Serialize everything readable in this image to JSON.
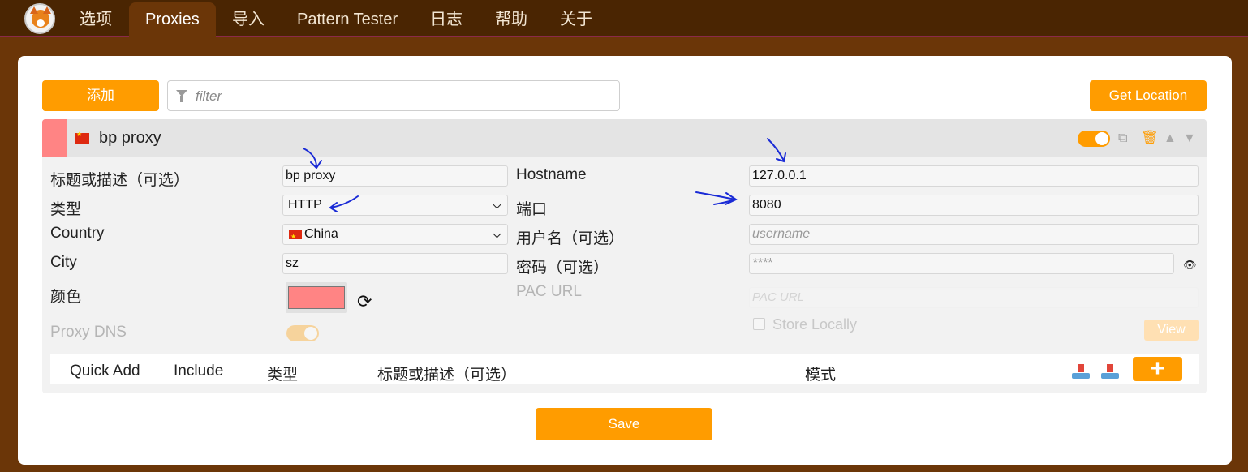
{
  "nav": {
    "items": [
      {
        "label": "选项"
      },
      {
        "label": "Proxies"
      },
      {
        "label": "导入"
      },
      {
        "label": "Pattern Tester"
      },
      {
        "label": "日志"
      },
      {
        "label": "帮助"
      },
      {
        "label": "关于"
      }
    ],
    "active": "Proxies"
  },
  "toolbar": {
    "add_label": "添加",
    "filter_placeholder": "filter",
    "get_location_label": "Get Location"
  },
  "proxy": {
    "title": "bp proxy",
    "enabled": true,
    "color": "#ff8484",
    "fields": {
      "title_label": "标题或描述（可选）",
      "title_value": "bp proxy",
      "type_label": "类型",
      "type_value": "HTTP",
      "country_label": "Country",
      "country_value": "China",
      "city_label": "City",
      "city_value": "sz",
      "color_label": "颜色",
      "proxy_dns_label": "Proxy DNS",
      "hostname_label": "Hostname",
      "hostname_value": "127.0.0.1",
      "port_label": "端口",
      "port_value": "8080",
      "username_label": "用户名（可选）",
      "username_placeholder": "username",
      "password_label": "密码（可选）",
      "password_placeholder": "****",
      "pac_label": "PAC URL",
      "pac_placeholder": "PAC URL",
      "store_locally_label": "Store Locally",
      "view_label": "View"
    },
    "patterns": {
      "headers": [
        "Quick Add",
        "Include",
        "类型",
        "标题或描述（可选）",
        "模式"
      ]
    }
  },
  "footer": {
    "save_label": "Save"
  },
  "colors": {
    "accent": "#ff9c00",
    "nav_bg": "#4a2502",
    "page_bg": "#6b3608",
    "proxy_color": "#ff8484"
  }
}
